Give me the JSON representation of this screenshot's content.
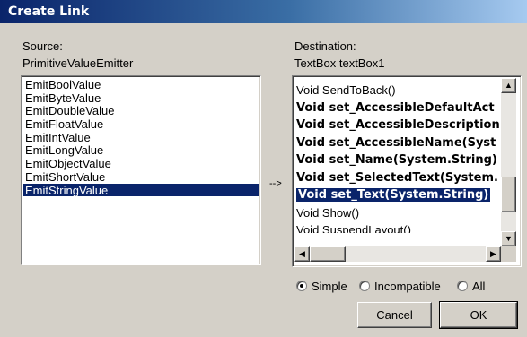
{
  "window": {
    "title": "Create Link"
  },
  "source": {
    "label": "Source:",
    "object": "PrimitiveValueEmitter",
    "items": [
      "EmitBoolValue",
      "EmitByteValue",
      "EmitDoubleValue",
      "EmitFloatValue",
      "EmitIntValue",
      "EmitLongValue",
      "EmitObjectValue",
      "EmitShortValue",
      "EmitStringValue"
    ],
    "selected_index": 8
  },
  "arrow": "-->",
  "destination": {
    "label": "Destination:",
    "object": "TextBox textBox1",
    "items": [
      {
        "text": "Void SendToBack()",
        "bold": false
      },
      {
        "text": "Void set_AccessibleDefaultAct",
        "bold": true
      },
      {
        "text": "Void set_AccessibleDescription",
        "bold": true
      },
      {
        "text": "Void set_AccessibleName(Syst",
        "bold": true
      },
      {
        "text": "Void set_Name(System.String)",
        "bold": true
      },
      {
        "text": "Void set_SelectedText(System.",
        "bold": true
      },
      {
        "text": "Void set_Text(System.String)",
        "bold": true
      },
      {
        "text": "Void Show()",
        "bold": false
      },
      {
        "text": "Void SuspendLayout()",
        "bold": false
      }
    ],
    "selected_index": 6,
    "vertical_scroll_position": 0.82,
    "horizontal_scroll_position": 0.0
  },
  "filter": {
    "options": [
      "Simple",
      "Incompatible",
      "All"
    ],
    "selected": "Simple"
  },
  "buttons": {
    "cancel": "Cancel",
    "ok": "OK"
  },
  "icons": {
    "scroll_up": "▲",
    "scroll_down": "▼",
    "scroll_left": "◀",
    "scroll_right": "▶"
  },
  "colors": {
    "selection": "#0a246a",
    "titlebar_start": "#0a246a",
    "titlebar_end": "#a6caf0",
    "face": "#d4d0c8"
  }
}
